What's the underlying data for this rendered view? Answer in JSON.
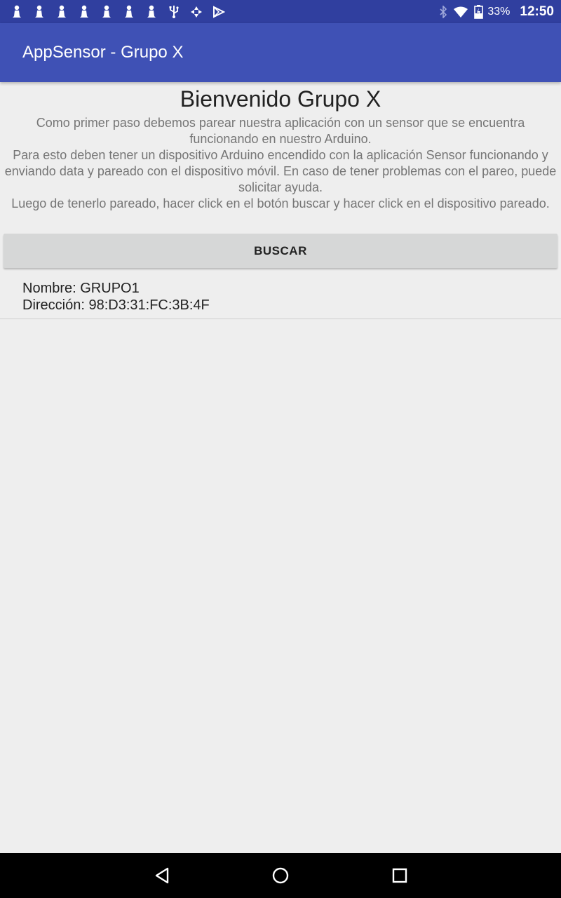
{
  "status_bar": {
    "notification_icons": [
      "chess-pawn-icon",
      "chess-pawn-icon",
      "chess-pawn-icon",
      "chess-pawn-icon",
      "chess-pawn-icon",
      "chess-pawn-icon",
      "chess-pawn-icon",
      "usb-icon",
      "sync-icon",
      "play-store-icon"
    ],
    "battery_percent": "33%",
    "time": "12:50"
  },
  "app_bar": {
    "title": "AppSensor - Grupo X"
  },
  "main": {
    "title": "Bienvenido Grupo X",
    "paragraphs": [
      "Como primer paso debemos parear nuestra aplicación con un sensor que se encuentra funcionando en nuestro Arduino.",
      "Para esto deben tener un dispositivo Arduino encendido con la aplicación Sensor funcionando y enviando data y pareado con el dispositivo móvil. En caso de tener problemas con el pareo, puede solicitar ayuda.",
      "Luego de tenerlo pareado, hacer click en el botón buscar y hacer click en el dispositivo pareado."
    ],
    "search_button_label": "BUSCAR",
    "devices": [
      {
        "name_line": "Nombre: GRUPO1",
        "address_line": "Dirección: 98:D3:31:FC:3B:4F"
      }
    ]
  },
  "colors": {
    "status_bar": "#303F9F",
    "app_bar": "#3F51B5",
    "background": "#EEEEEE",
    "button": "#D6D7D7"
  }
}
